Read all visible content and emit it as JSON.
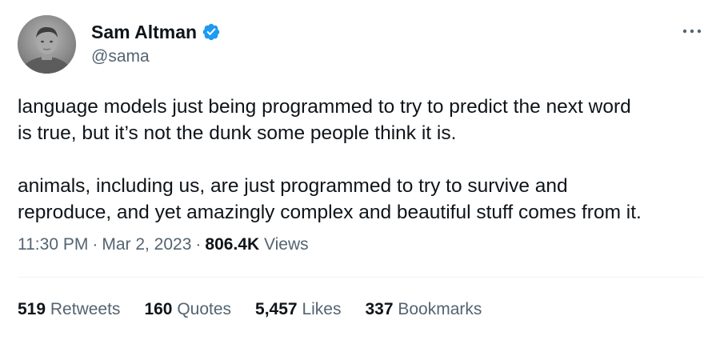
{
  "author": {
    "display_name": "Sam Altman",
    "handle": "@sama",
    "verified": true
  },
  "icons": {
    "verified": "verified-badge-icon",
    "more": "more-options-icon"
  },
  "tweet": {
    "paragraphs": [
      "language models just being programmed to try to predict the next word\nis true, but it’s not the dunk some people think it is.",
      "animals, including us, are just programmed to try to survive and\nreproduce, and yet amazingly complex and beautiful stuff comes from it."
    ]
  },
  "meta": {
    "time": "11:30 PM",
    "separator": "·",
    "date": "Mar 2, 2023",
    "views_count": "806.4K",
    "views_label": "Views"
  },
  "stats": {
    "retweets": {
      "count": "519",
      "label": "Retweets"
    },
    "quotes": {
      "count": "160",
      "label": "Quotes"
    },
    "likes": {
      "count": "5,457",
      "label": "Likes"
    },
    "bookmarks": {
      "count": "337",
      "label": "Bookmarks"
    }
  },
  "colors": {
    "text_primary": "#0f1419",
    "text_secondary": "#536471",
    "verified_blue": "#1d9bf0",
    "divider": "#eff3f4"
  }
}
